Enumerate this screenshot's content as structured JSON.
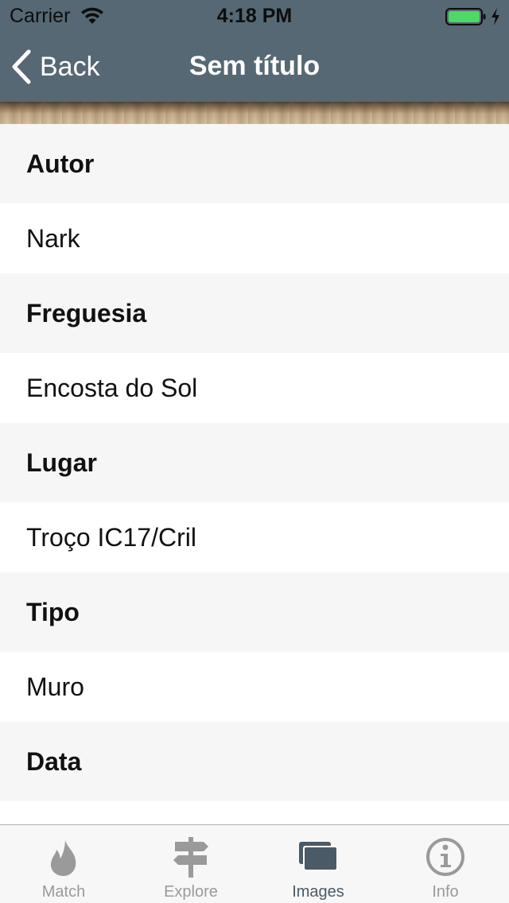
{
  "status_bar": {
    "carrier": "Carrier",
    "time": "4:18 PM",
    "battery_color": "#4cd964"
  },
  "nav": {
    "back_label": "Back",
    "title": "Sem título",
    "background_color": "#566873"
  },
  "details": {
    "autor": {
      "label": "Autor",
      "value": "Nark"
    },
    "freguesia": {
      "label": "Freguesia",
      "value": "Encosta do Sol"
    },
    "lugar": {
      "label": "Lugar",
      "value": "Troço IC17/Cril"
    },
    "tipo": {
      "label": "Tipo",
      "value": "Muro"
    },
    "data": {
      "label": "Data"
    }
  },
  "tab_bar": {
    "tabs": [
      {
        "label": "Match",
        "icon": "flame-icon",
        "active": false
      },
      {
        "label": "Explore",
        "icon": "signpost-icon",
        "active": false
      },
      {
        "label": "Images",
        "icon": "images-icon",
        "active": true
      },
      {
        "label": "Info",
        "icon": "info-icon",
        "active": false
      }
    ],
    "active_color": "#4a5a66",
    "inactive_color": "#9a9a9a"
  }
}
